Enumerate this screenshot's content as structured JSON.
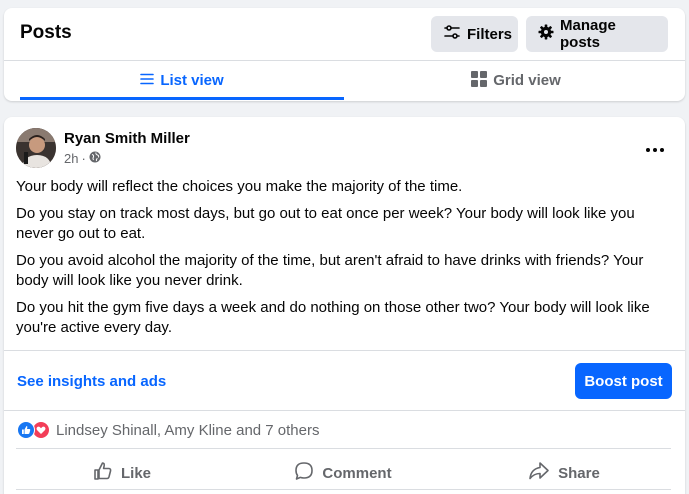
{
  "header": {
    "title": "Posts",
    "filters_label": "Filters",
    "manage_label": "Manage posts",
    "tabs": [
      {
        "label": "List view",
        "active": true
      },
      {
        "label": "Grid view",
        "active": false
      }
    ]
  },
  "post": {
    "author": "Ryan Smith Miller",
    "time": "2h",
    "separator": "·",
    "paragraphs": [
      "Your body will reflect the choices you make the majority of the time.",
      "Do you stay on track most days, but go out to eat once per week? Your body will look like you never go out to eat.",
      "Do you avoid alcohol the majority of the time, but aren't afraid to have drinks with friends? Your body will look like you never drink.",
      "Do you hit the gym five days a week and do nothing on those other two? Your body will look like you're active every day."
    ],
    "insights_label": "See insights and ads",
    "boost_label": "Boost post",
    "reactions_text": "Lindsey Shinall, Amy Kline and 7 others",
    "actions": {
      "like": "Like",
      "comment": "Comment",
      "share": "Share"
    }
  },
  "icons": {
    "filters": "sliders-icon",
    "manage": "gear-icon",
    "list": "list-icon",
    "grid": "grid-icon",
    "privacy": "globe-icon",
    "more": "more-icon"
  },
  "colors": {
    "accent": "#0866ff",
    "like_react": "#1877f2",
    "love_react": "#f33e58",
    "muted": "#65676b"
  }
}
